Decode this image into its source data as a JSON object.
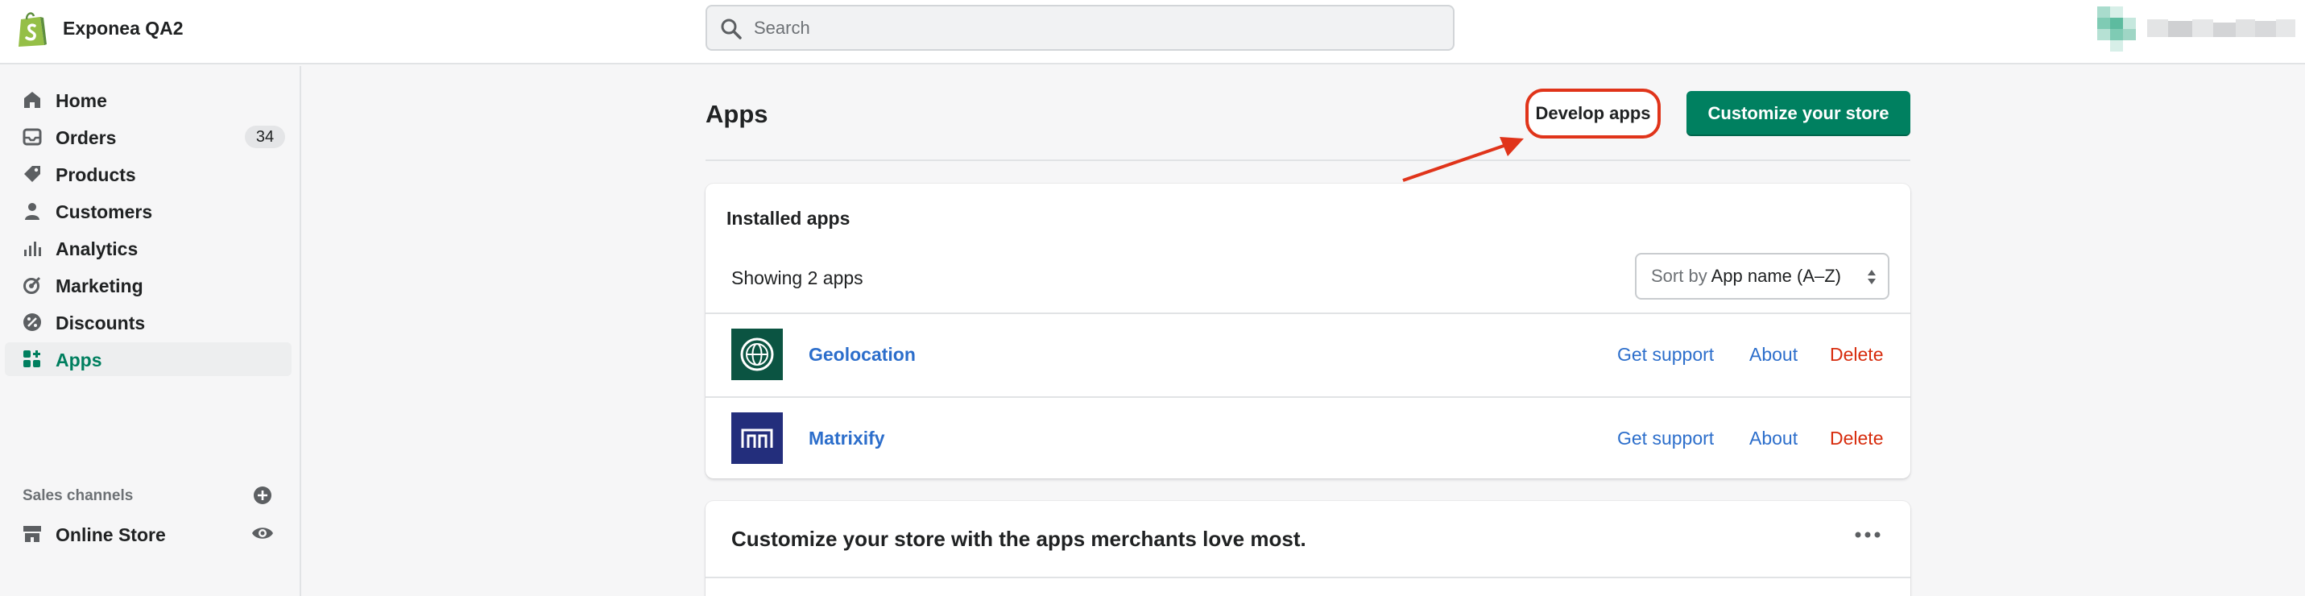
{
  "topbar": {
    "store_name": "Exponea QA2",
    "search_placeholder": "Search",
    "logo_icon": "shopify-bag-icon",
    "avatar_icon": "avatar"
  },
  "sidebar": {
    "items": [
      {
        "label": "Home",
        "icon": "home-icon"
      },
      {
        "label": "Orders",
        "icon": "orders-icon",
        "badge": "34"
      },
      {
        "label": "Products",
        "icon": "tag-icon"
      },
      {
        "label": "Customers",
        "icon": "person-icon"
      },
      {
        "label": "Analytics",
        "icon": "bar-chart-icon"
      },
      {
        "label": "Marketing",
        "icon": "target-icon"
      },
      {
        "label": "Discounts",
        "icon": "discount-icon"
      },
      {
        "label": "Apps",
        "icon": "apps-icon",
        "active": true
      }
    ],
    "sales_channels_title": "Sales channels",
    "channels": [
      {
        "label": "Online Store",
        "icon": "store-icon"
      }
    ]
  },
  "main": {
    "title": "Apps",
    "develop_apps_label": "Develop apps",
    "customize_label": "Customize your store",
    "installed": {
      "title": "Installed apps",
      "showing": "Showing 2 apps",
      "sort_prefix": "Sort by",
      "sort_value": "App name (A–Z)",
      "apps": [
        {
          "name": "Geolocation",
          "support": "Get support",
          "about": "About",
          "delete": "Delete",
          "logo_color": "#0b5442"
        },
        {
          "name": "Matrixify",
          "support": "Get support",
          "about": "About",
          "delete": "Delete",
          "logo_color": "#232e7c"
        }
      ]
    },
    "recommend_title": "Customize your store with the apps merchants love most."
  },
  "colors": {
    "accent_green": "#008060",
    "link_blue": "#2c6ecb",
    "delete_red": "#d72c0d",
    "annotation_red": "#e0341a"
  }
}
